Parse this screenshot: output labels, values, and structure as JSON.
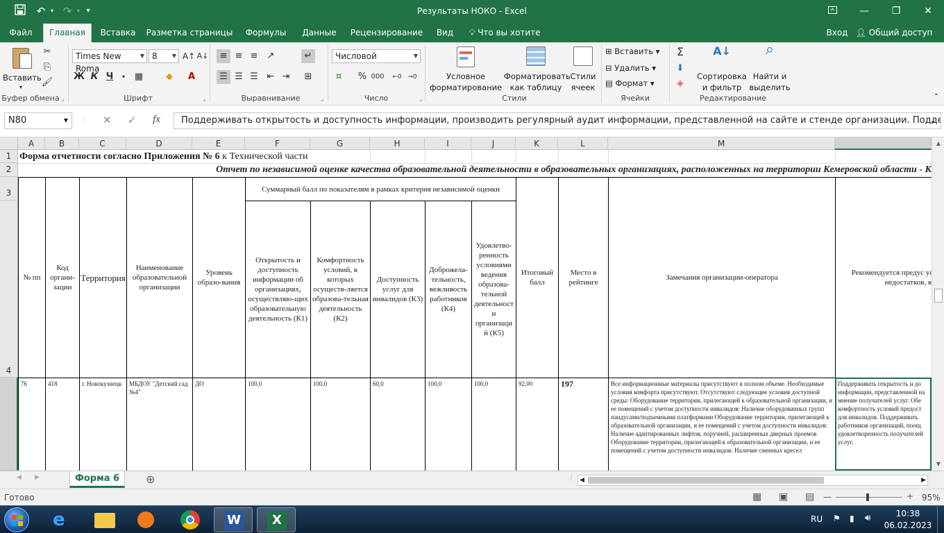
{
  "window": {
    "title": "Результаты НОКО - Excel",
    "save_icon": "save-icon",
    "undo_icon": "undo-icon",
    "redo_icon": "redo-icon",
    "ribbon_display_icon": "ribbon-display-icon",
    "minimize": "—",
    "restore": "❐",
    "close": "✕"
  },
  "ribbon_tabs": [
    "Файл",
    "Главная",
    "Вставка",
    "Разметка страницы",
    "Формулы",
    "Данные",
    "Рецензирование",
    "Вид"
  ],
  "tell_me": "Что вы хотите сделать?",
  "signin": "Вход",
  "share": "Общий доступ",
  "ribbon": {
    "clipboard": {
      "paste": "Вставить",
      "label": "Буфер обмена"
    },
    "font": {
      "name": "Times New Roma",
      "size": "8",
      "bold": "Ж",
      "italic": "К",
      "underline": "Ч",
      "label": "Шрифт"
    },
    "alignment": {
      "label": "Выравнивание"
    },
    "number": {
      "format": "Числовой",
      "label": "Число",
      "percent": "%",
      "thousands": "000"
    },
    "styles": {
      "conditional_1": "Условное",
      "conditional_2": "форматирование",
      "as_table_1": "Форматировать",
      "as_table_2": "как таблицу",
      "cell_styles_1": "Стили",
      "cell_styles_2": "ячеек",
      "label": "Стили"
    },
    "cells": {
      "insert": "Вставить",
      "delete": "Удалить",
      "format": "Формат",
      "label": "Ячейки"
    },
    "editing": {
      "sort_1": "Сортировка",
      "sort_2": "и фильтр",
      "find_1": "Найти и",
      "find_2": "выделить",
      "label": "Редактирование"
    }
  },
  "formula_bar": {
    "name_box": "N80",
    "fx": "fx",
    "content": "Поддерживать открытость и доступность информации, производить регулярный аудит информации, представленной на сайте и стенде организации.  Поддерживать"
  },
  "columns": [
    "A",
    "B",
    "C",
    "D",
    "E",
    "F",
    "G",
    "H",
    "I",
    "J",
    "K",
    "L",
    "M",
    ""
  ],
  "rows": [
    "1",
    "2",
    "3",
    "4",
    ""
  ],
  "sheet": {
    "row1_bold": "Форма отчетности согласно Приложения № 6",
    "row1_rest": " к Технической части",
    "row2": "Отчет по независимой оценке качества образовательной деятельности в образовательных организациях, расположенных на территории Кемеровской области - К",
    "group_header": "Суммарный балл по показателям в рамках критерия независимой оценки",
    "headers": {
      "A": "№ пп",
      "B": "Код органи-зации",
      "C": "Территория",
      "D": "Наименование образовательной организации",
      "E": "Уровень образо-вания",
      "F": "Открытость и доступность информации об организациях, осуществляю-щих образовательную деятельность (К1)",
      "G": "Комфортность условий, в которых осуществ-ляется образова-тельная деятельность (К2)",
      "H": "Доступность услуг для инвалидов (К3)",
      "I": "Доброжела-тельность, вежливость работников (К4)",
      "J": "Удовлетво-ренность условиями ведения образова-тельной деятельност и организаци й (К5)",
      "K": "Итоговый балл",
      "L": "Место в рейтинге",
      "M": "Замечания организации-оператора",
      "N": "Рекомендуется предус устранению недостатков, в"
    },
    "data_row": {
      "A": "76",
      "B": "418",
      "C": "г. Новокузнецк",
      "D": "МБДОУ \"Детский сад №4\"",
      "E": "ДО",
      "F": "100,0",
      "G": "100,0",
      "H": "60,0",
      "I": "100,0",
      "J": "100,0",
      "K": "92,00",
      "L": "197",
      "M": "Все информационные материалы присутствуют в полном объеме. Необходимые условия комфорта присутствуют. Отсутствуют следующие условия доступной среды: Оборудование территории, прилегающей к образовательной организации, и ее помещений с учетом доступности инвалидов: Наличие оборудованных групп пандусами/подъемными платформами Оборудование территории, прилегающей к образовательной организации, и ее помещений с учетом доступности инвалидов: Наличие адаптированных лифтов, поручней, расширенных дверных проемов Оборудование территории, прилегающей к образовательной организации, и ее помещений с учетом доступности инвалидов: Наличие сменных кресел",
      "N": "Поддерживать открытость и до информации, представленной на мнение получателей услуг. Обе комфортность условий предост для инвалидов. Поддерживать работников организаций, поощ удовлетворенность получателей услуг."
    }
  },
  "sheet_tab": "Форма 6",
  "add_sheet": "⊕",
  "status": {
    "ready": "Готово",
    "zoom": "95%",
    "minus": "—",
    "plus": "+"
  },
  "taskbar": {
    "lang": "RU",
    "time": "10:38",
    "date": "06.02.2023"
  }
}
